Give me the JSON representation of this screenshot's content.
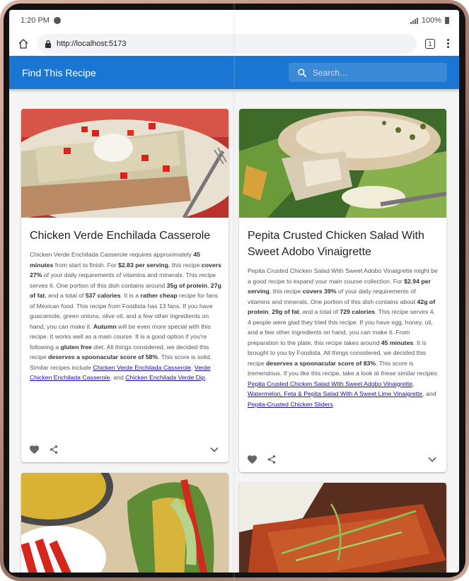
{
  "status": {
    "time": "1:20 PM",
    "battery": "100%"
  },
  "browser": {
    "url": "http://localhost:5173",
    "tab_count": "1"
  },
  "app": {
    "title": "Find This Recipe",
    "search_placeholder": "Search…"
  },
  "recipes": [
    {
      "title": "Chicken Verde Enchilada Casserole",
      "d": {
        "t0": "Chicken Verde Enchilada Casserole requires approximately ",
        "b1": "45 minutes",
        "t1": " from start to finish. For ",
        "b2": "$2.83 per serving",
        "t2": ", this recipe ",
        "b3": "covers 27%",
        "t3": " of your daily requirements of vitamins and minerals. This recipe serves 6. One portion of this dish contains around ",
        "b4": "35g of protein",
        "t4": ", ",
        "b5": "27g of fat",
        "t5": ", and a total of ",
        "b6": "537 calories",
        "t6": ". It is a ",
        "b7": "rather cheap",
        "t7": " recipe for fans of Mexican food. This recipe from Foodista has 13 fans. If you have guacamole, green onions, olive oil, and a few other ingredients on hand, you can make it. ",
        "b8": "Autumn",
        "t8": " will be even more special with this recipe. It works well as a main course. It is a good option if you're following a ",
        "b9": "gluten free",
        "t9": " diet. All things considered, we decided this recipe ",
        "b10": "deserves a spoonacular score of 58%",
        "t10": ". This score is solid. Similar recipes include ",
        "l1": "Chicken Verde Enchilada Casserole",
        "t11": ", ",
        "l2": "Verde Chicken Enchilada Casserole",
        "t12": ", and ",
        "l3": "Chicken Enchilada Verde Dip",
        "t13": "."
      }
    },
    {
      "title": "Pepita Crusted Chicken Salad With Sweet Adobo Vinaigrette",
      "d": {
        "t0": "Pepita Crusted Chicken Salad With Sweet Adobo Vinaigrette might be a good recipe to expand your main course collection. For ",
        "b1": "$2.94 per serving",
        "t1": ", this recipe ",
        "b2": "covers 39%",
        "t2": " of your daily requirements of vitamins and minerals. One portion of this dish contains about ",
        "b3": "42g of protein",
        "t3": ", ",
        "b4": "29g of fat",
        "t4": ", and a total of ",
        "b5": "729 calories",
        "t5": ". This recipe serves 4. 4 people were glad they tried this recipe. If you have egg, honey, oil, and a few other ingredients on hand, you can make it. From preparation to the plate, this recipe takes around ",
        "b6": "45 minutes",
        "t6": ". It is brought to you by Foodista. All things considered, we decided this recipe ",
        "b7": "deserves a spoonacular score of 83%",
        "t7": ". This score is tremendous. If you like this recipe, take a look at these similar recipes: ",
        "l1": "Pepita Crusted Chicken Salad With Sweet Adobo Vinaigrette",
        "t8": ", ",
        "l2": "Watermelon, Feta & Pepita Salad With A Sweet Lime Vinaigrette",
        "t9": ", and ",
        "l3": "Pepita-Crusted Chicken Sliders",
        "t10": "."
      }
    }
  ],
  "icons": {
    "favorite": "heart-icon",
    "share": "share-icon",
    "expand": "chevron-down-icon",
    "search": "search-icon",
    "home": "home-icon",
    "lock": "lock-icon"
  },
  "colors": {
    "app_bar": "#1976d2",
    "link": "#1a0dab",
    "background": "#f5f5f5"
  }
}
